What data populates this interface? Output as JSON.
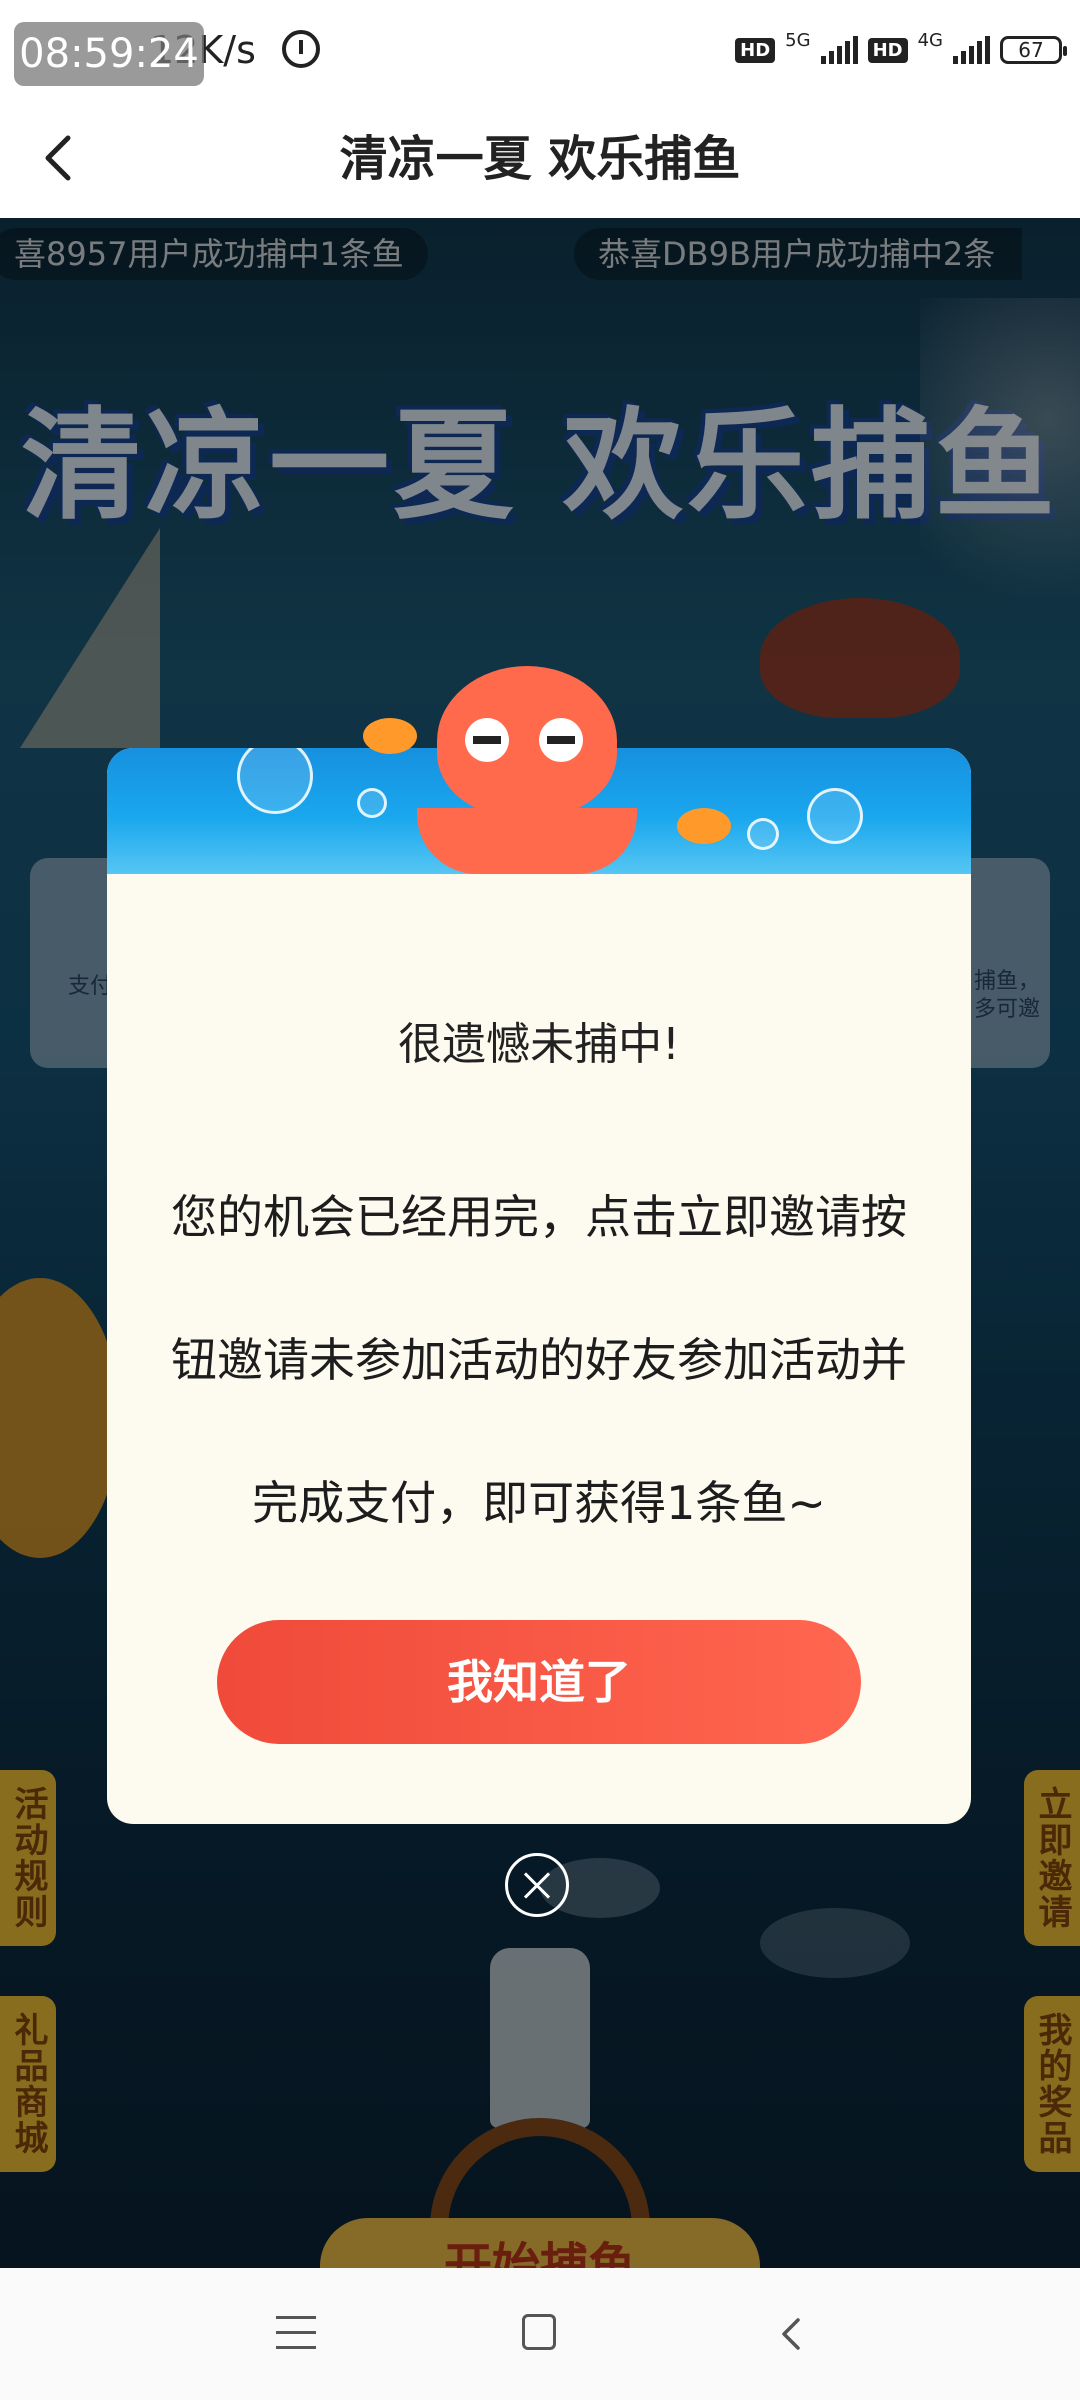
{
  "status_bar": {
    "time": "08:59:24",
    "net_speed": "12K/s",
    "hd_badge_1": "HD",
    "net_type_1": "5G",
    "hd_badge_2": "HD",
    "net_type_2": "4G",
    "battery": "67"
  },
  "header": {
    "title": "清凉一夏 欢乐捕鱼",
    "back_icon": "chevron-left-icon"
  },
  "game": {
    "ticker_1": "喜8957用户成功捕中1条鱼",
    "ticker_2": "恭喜DB9B用户成功捕中2条",
    "banner_title": "清凉一夏 欢乐捕鱼",
    "side_card_left_text": "支付",
    "side_card_right_text": "捕鱼，\n多可邀",
    "tab_rules": "活动规则",
    "tab_shop": "礼品商城",
    "tab_invite": "立即邀请",
    "tab_prizes": "我的奖品",
    "start_button": "开始捕鱼"
  },
  "dialog": {
    "title": "很遗憾未捕中!",
    "body_lines": [
      "您的机会已经用完，点击立即邀请按",
      "钮邀请未参加活动的好友参加活动并",
      "完成支付，即可获得1条鱼~"
    ],
    "ok_button": "我知道了",
    "close_icon": "close-circle-icon"
  },
  "nav_bar": {
    "menu_icon": "menu-icon",
    "home_icon": "home-square-icon",
    "back_icon": "back-triangle-icon"
  },
  "colors": {
    "dialog_bg": "#fdfaf0",
    "ok_button": "#f04a3a",
    "side_tab": "#f7c638",
    "water": "#1aa7ee"
  }
}
